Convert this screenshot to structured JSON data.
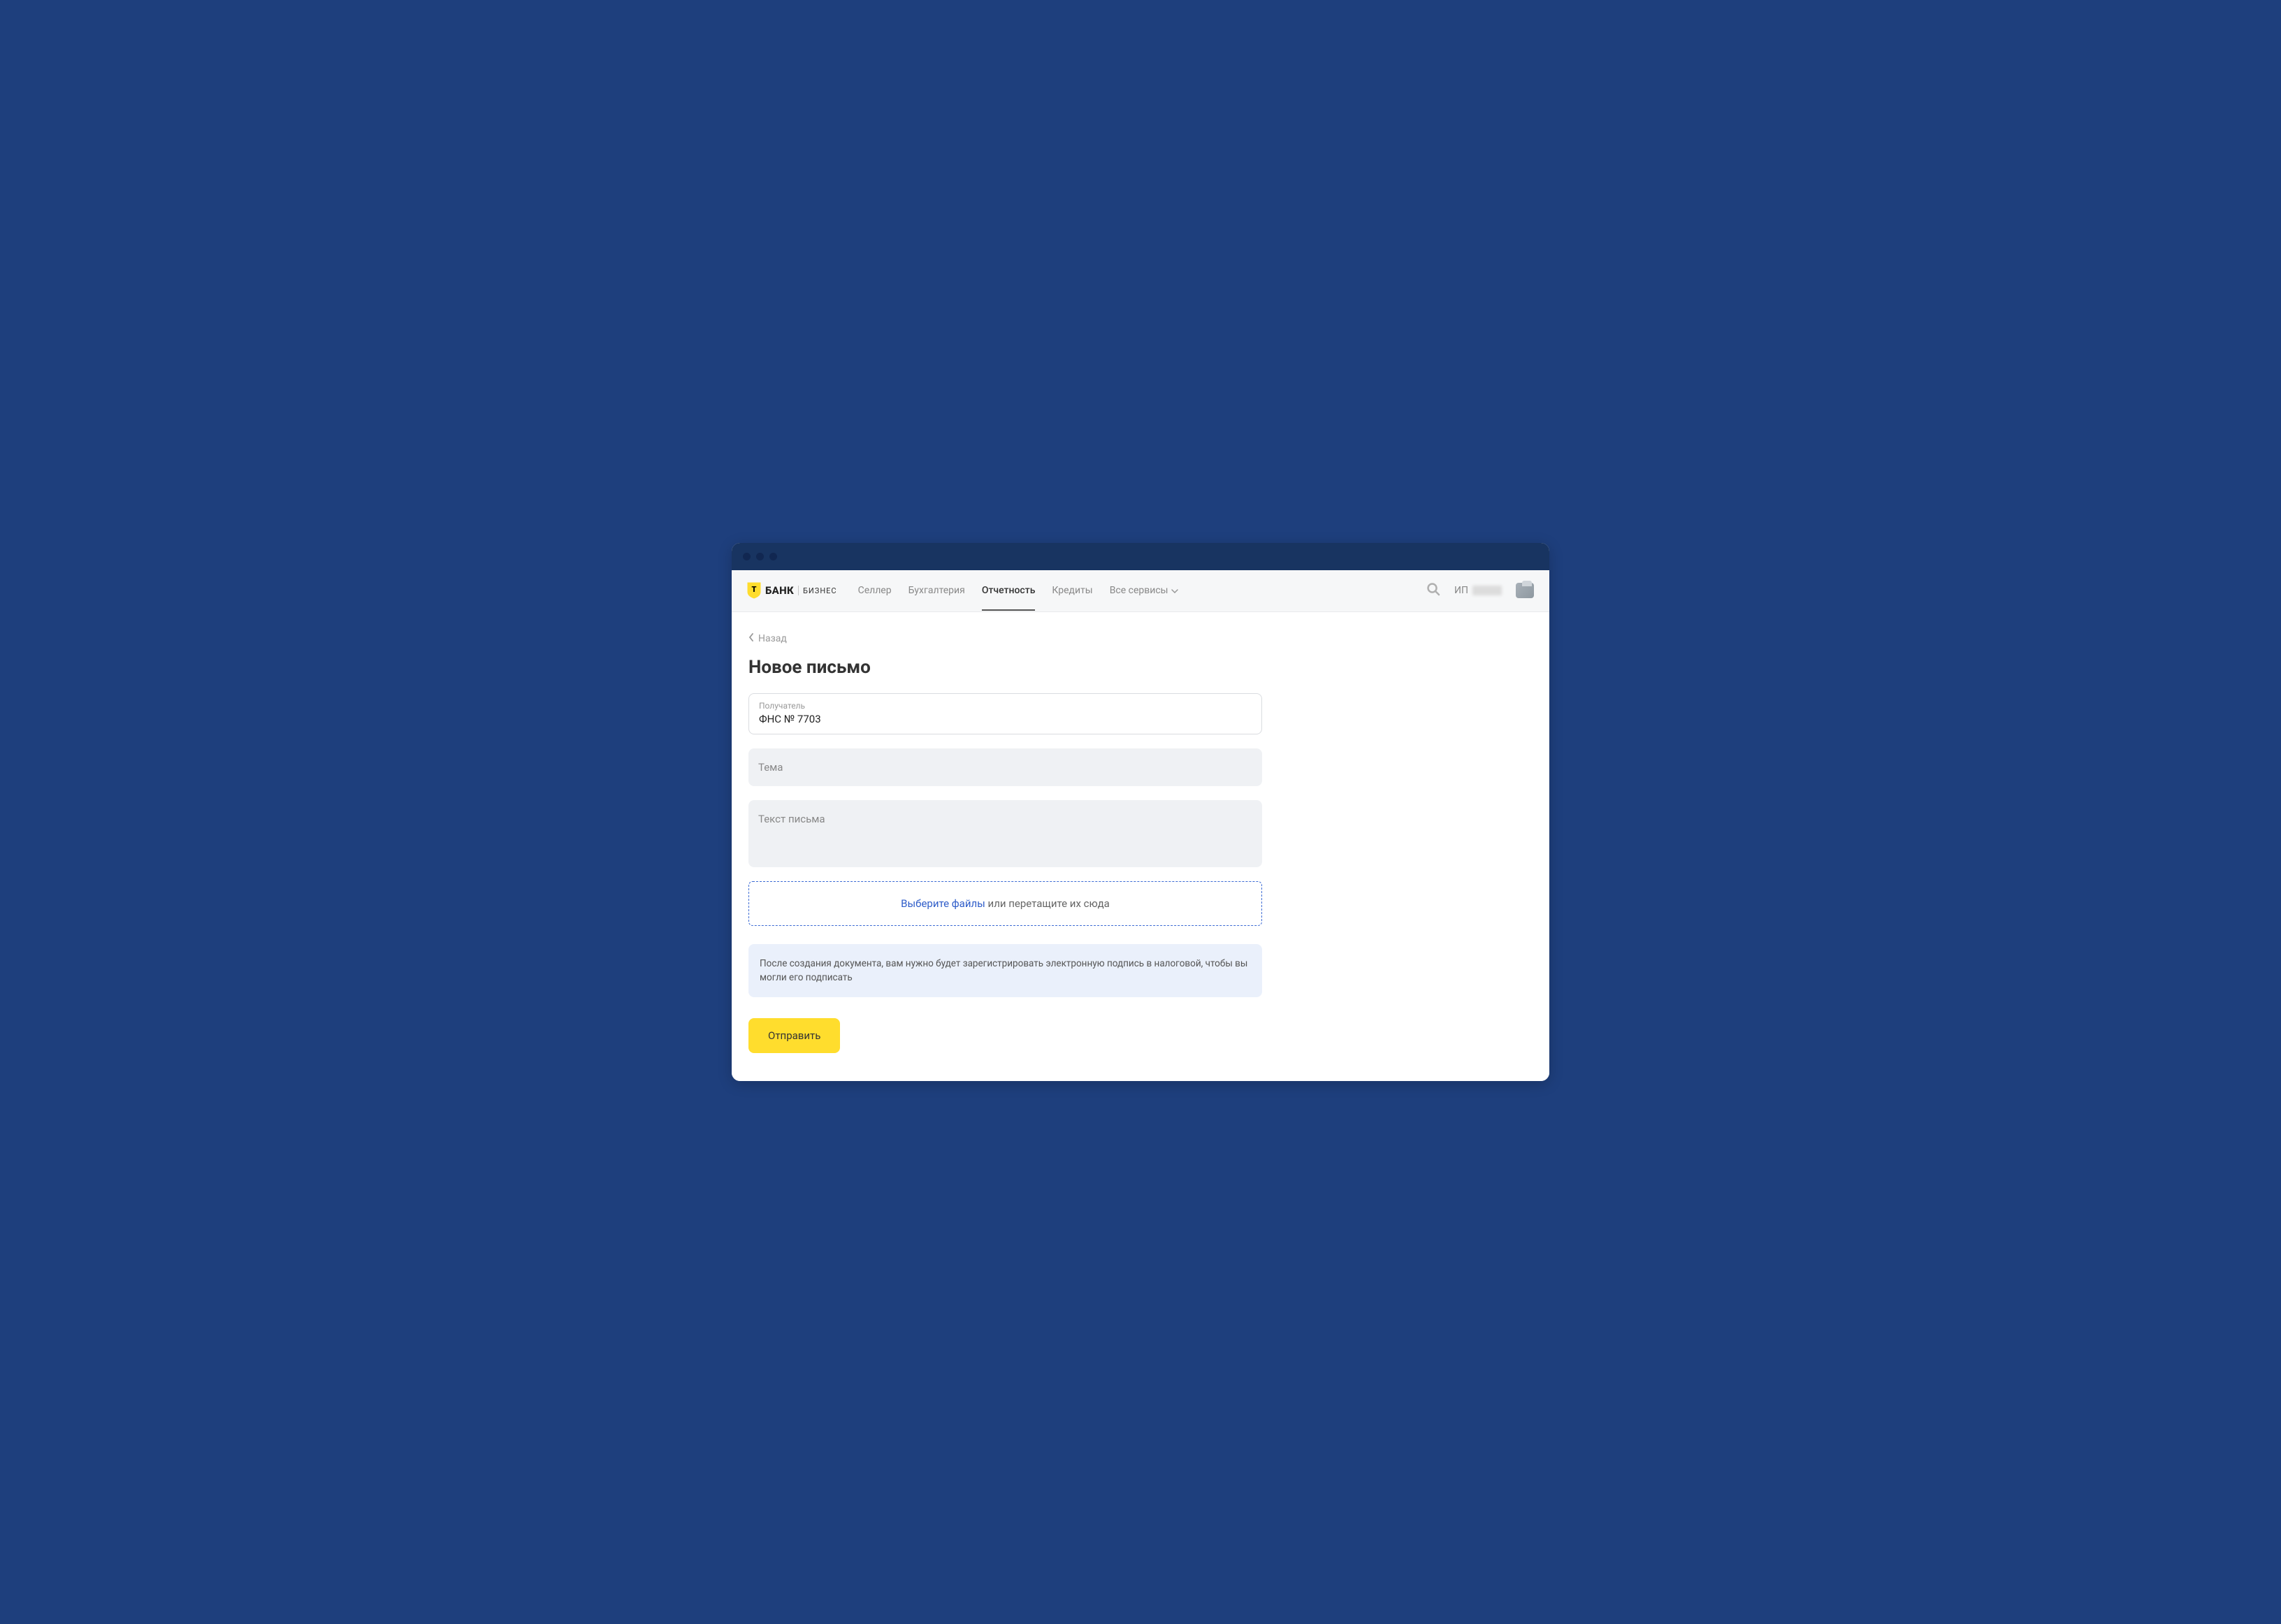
{
  "logo": {
    "bank": "БАНК",
    "business": "БИЗНЕС"
  },
  "nav": {
    "items": [
      {
        "label": "Селлер",
        "active": false
      },
      {
        "label": "Бухгалтерия",
        "active": false
      },
      {
        "label": "Отчетность",
        "active": true
      },
      {
        "label": "Кредиты",
        "active": false
      },
      {
        "label": "Все сервисы",
        "active": false,
        "dropdown": true
      }
    ]
  },
  "user": {
    "prefix": "ИП"
  },
  "back": {
    "label": "Назад"
  },
  "page": {
    "title": "Новое письмо"
  },
  "form": {
    "recipient": {
      "label": "Получатель",
      "value": "ФНС № 7703"
    },
    "subject": {
      "placeholder": "Тема"
    },
    "body": {
      "placeholder": "Текст письма"
    },
    "dropzone": {
      "link": "Выберите файлы",
      "text": " или перетащите их сюда"
    },
    "notice": "После создания документа, вам нужно будет зарегистрировать электронную подпись в налоговой, чтобы вы могли его подписать",
    "submit": "Отправить"
  }
}
